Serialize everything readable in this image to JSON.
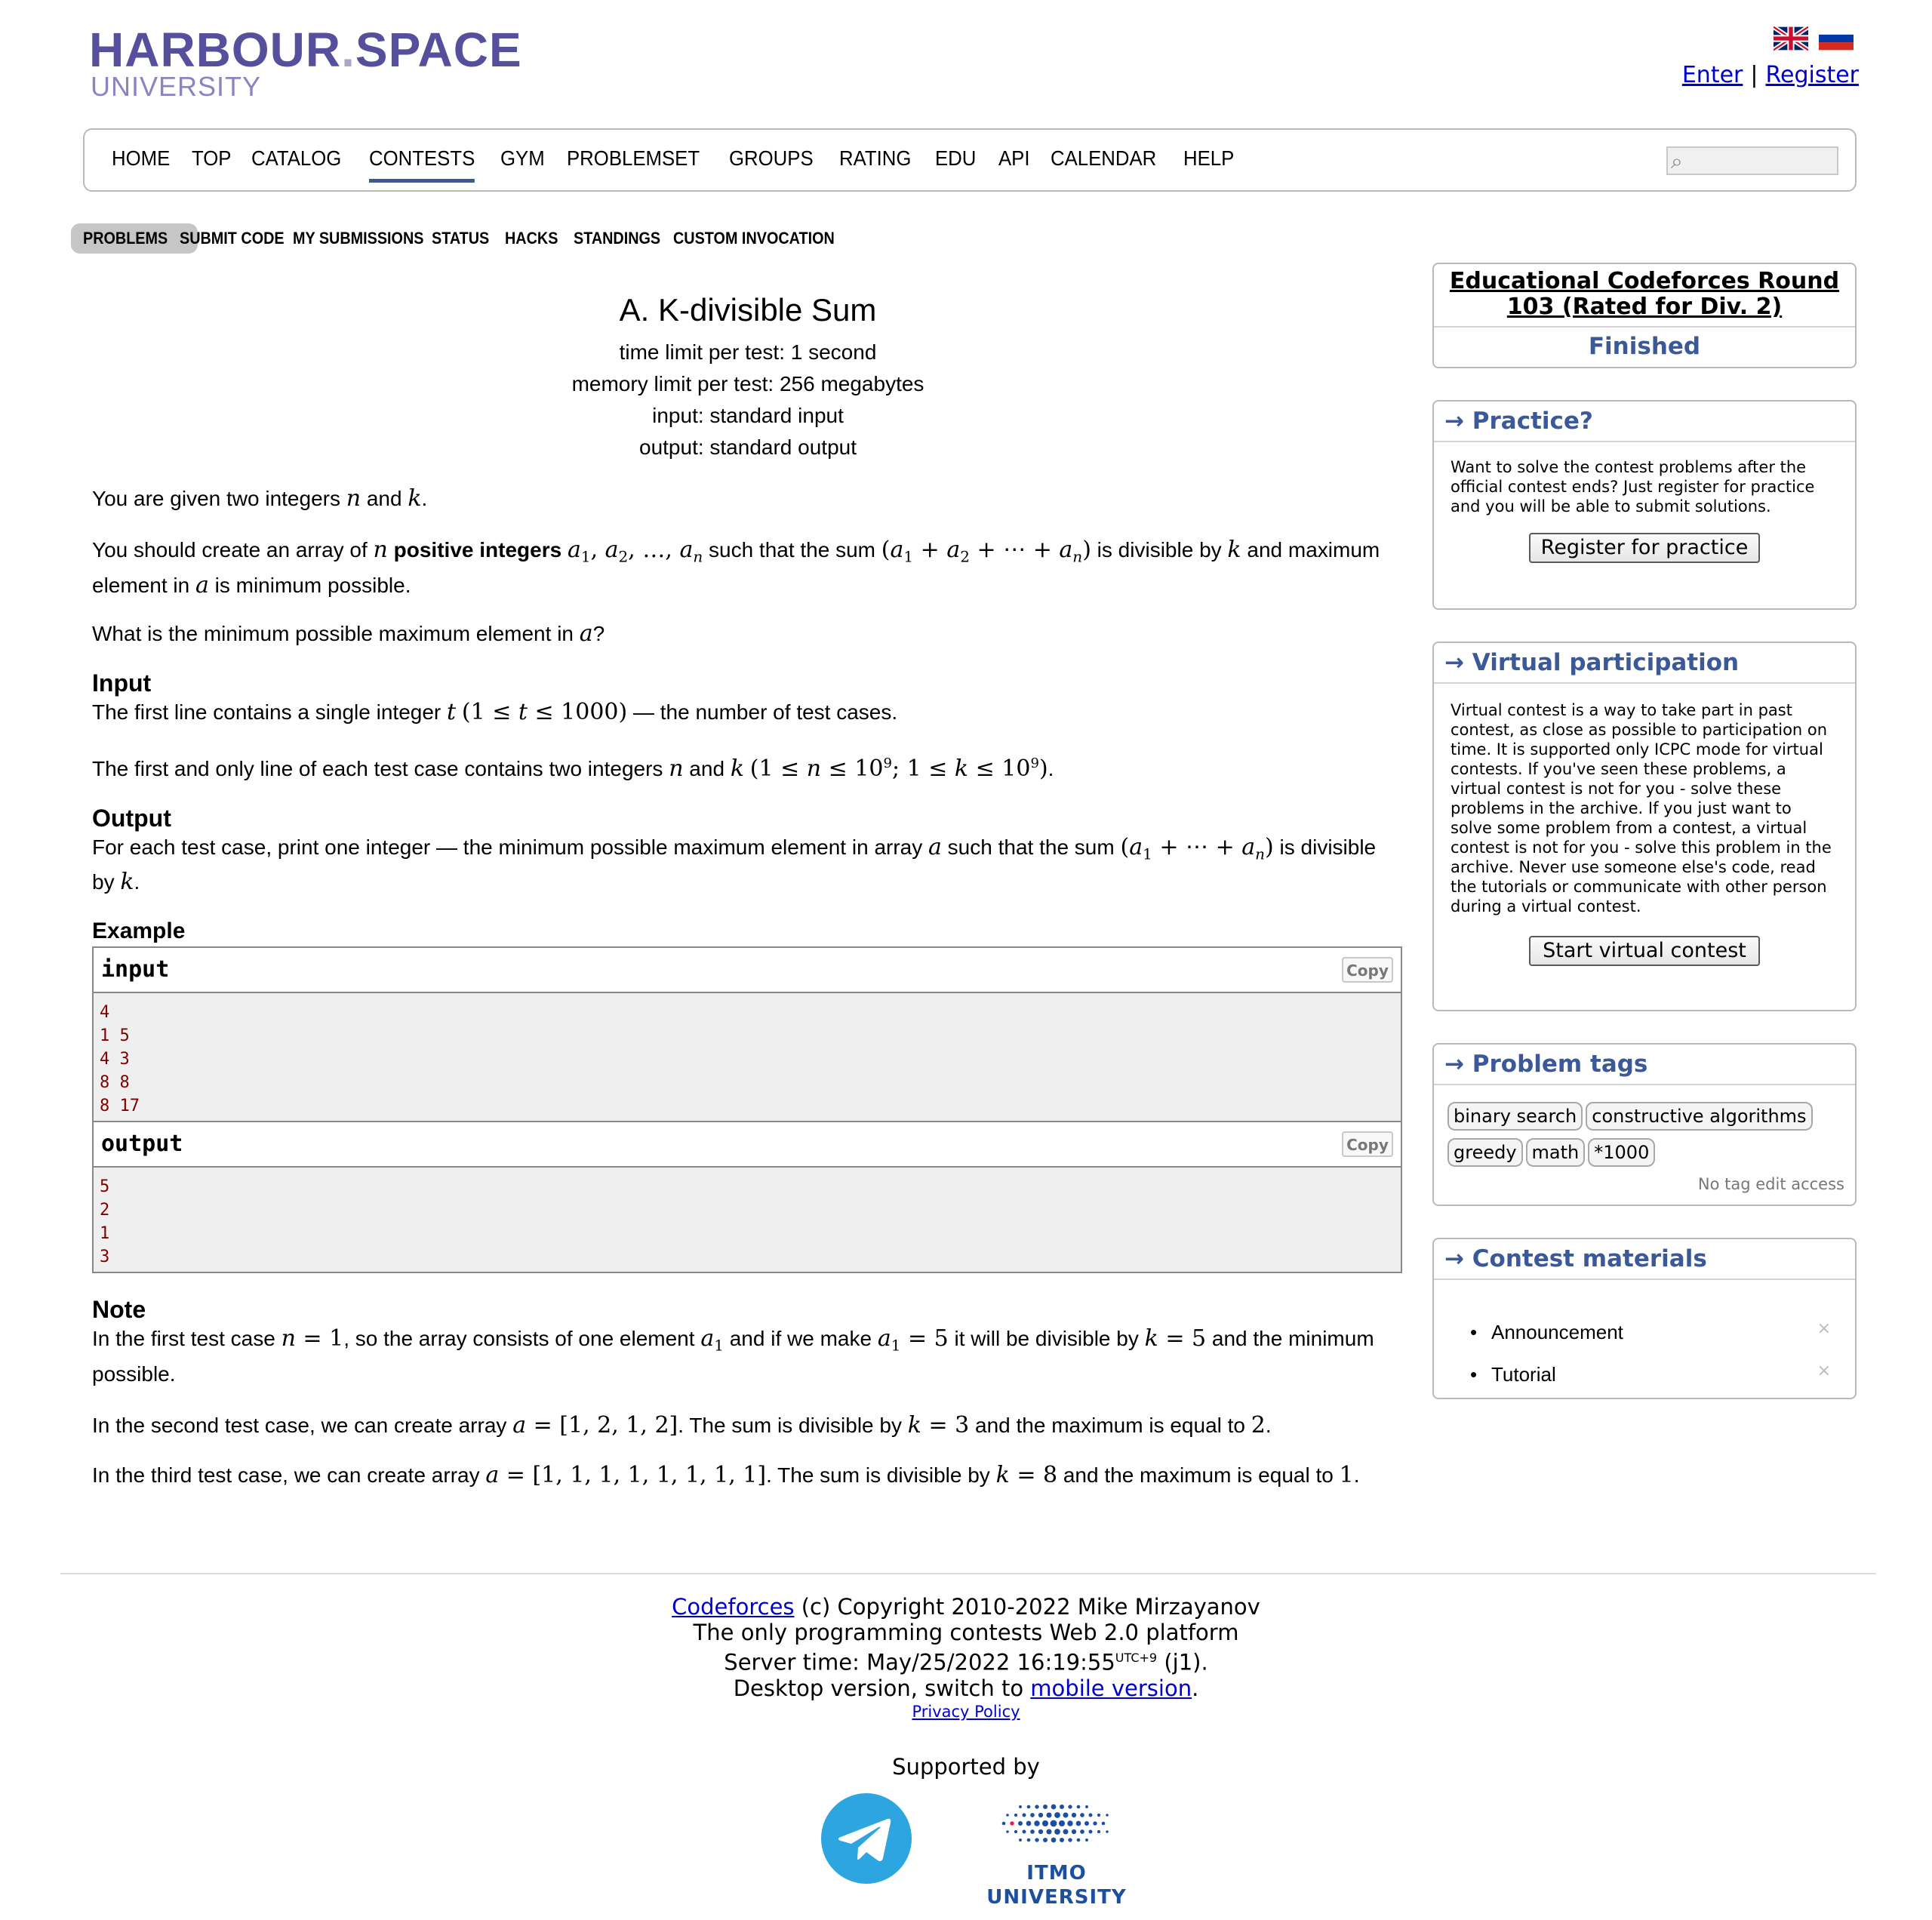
{
  "header": {
    "logo_main": "HARBOUR",
    "logo_dot": ".",
    "logo_space": "SPACE",
    "logo_sub": "UNIVERSITY",
    "enter_link": "Enter",
    "separator": "|",
    "register_link": "Register",
    "flags": [
      "english-flag",
      "russian-flag"
    ]
  },
  "main_menu": {
    "items": [
      "HOME",
      "TOP",
      "CATALOG",
      "CONTESTS",
      "GYM",
      "PROBLEMSET",
      "GROUPS",
      "RATING",
      "EDU",
      "API",
      "CALENDAR",
      "HELP"
    ],
    "current": "CONTESTS",
    "search_icon": "search-icon"
  },
  "sub_menu": {
    "items": [
      "PROBLEMS",
      "SUBMIT CODE",
      "MY SUBMISSIONS",
      "STATUS",
      "HACKS",
      "STANDINGS",
      "CUSTOM INVOCATION"
    ],
    "current": "PROBLEMS"
  },
  "problem": {
    "title": "A. K-divisible Sum",
    "time_limit": "time limit per test: 1 second",
    "memory_limit": "memory limit per test: 256 megabytes",
    "input_file": "input: standard input",
    "output_file": "output: standard output",
    "statement": {
      "p1_pre": "You are given two integers ",
      "p1_and": " and ",
      "p1_end": ".",
      "p2_pre": "You should create an array of ",
      "p2_bold": " positive integers ",
      "p2_mid": " such that the sum ",
      "p2_mid2": " is divisible by ",
      "p2_mid3": " and maximum element in ",
      "p2_end": " is minimum possible.",
      "p3_pre": "What is the minimum possible maximum element in ",
      "p3_end": "?"
    },
    "input_section": {
      "title": "Input",
      "p1_pre": "The first line contains a single integer ",
      "p1_end": " — the number of test cases.",
      "p2_pre": "The first and only line of each test case contains two integers ",
      "p2_and": " and ",
      "p2_end": "."
    },
    "output_section": {
      "title": "Output",
      "p1_pre": "For each test case, print one integer — the minimum possible maximum element in array ",
      "p1_mid": " such that the sum ",
      "p1_mid2": " is divisible by ",
      "p1_end": "."
    },
    "example_title": "Example",
    "sample_input_label": "input",
    "sample_output_label": "output",
    "copy_label": "Copy",
    "sample_input_lines": [
      "4",
      "1 5",
      "4 3",
      "8 8",
      "8 17"
    ],
    "sample_output_lines": [
      "5",
      "2",
      "1",
      "3"
    ],
    "note": {
      "title": "Note",
      "p1_pre": "In the first test case ",
      "p1_mid": ", so the array consists of one element ",
      "p1_mid2": " and if we make ",
      "p1_mid3": " it will be divisible by ",
      "p1_end": " and the minimum possible.",
      "p2_pre": "In the second test case, we can create array ",
      "p2_mid": ". The sum is divisible by ",
      "p2_mid2": " and the maximum is equal to ",
      "p2_end": ".",
      "p3_pre": "In the third test case, we can create array ",
      "p3_mid": ". The sum is divisible by ",
      "p3_mid2": " and the maximum is equal to ",
      "p3_end": "."
    }
  },
  "sidebar": {
    "contest_name": "Educational Codeforces Round 103 (Rated for Div. 2)",
    "contest_status": "Finished",
    "practice": {
      "title": "→ Practice?",
      "text": "Want to solve the contest problems after the official contest ends? Just register for practice and you will be able to submit solutions.",
      "button": "Register for practice"
    },
    "virtual": {
      "title": "→ Virtual participation",
      "text": "Virtual contest is a way to take part in past contest, as close as possible to participation on time. It is supported only ICPC mode for virtual contests. If you've seen these problems, a virtual contest is not for you - solve these problems in the archive. If you just want to solve some problem from a contest, a virtual contest is not for you - solve this problem in the archive. Never use someone else's code, read the tutorials or communicate with other person during a virtual contest.",
      "button": "Start virtual contest"
    },
    "tags": {
      "title": "→ Problem tags",
      "items": [
        "binary search",
        "constructive algorithms",
        "greedy",
        "math",
        "*1000"
      ],
      "note": "No tag edit access"
    },
    "materials": {
      "title": "→ Contest materials",
      "items": [
        "Announcement",
        "Tutorial"
      ],
      "remove_icon": "×"
    }
  },
  "footer": {
    "codeforces_link": "Codeforces",
    "copyright": " (c) Copyright 2010-2022 Mike Mirzayanov",
    "platform": "The only programming contests Web 2.0 platform",
    "server_time_pre": "Server time: May/25/2022 16:19:55",
    "server_time_tz": "UTC+9",
    "server_time_post": " (j1).",
    "desktop_pre": "Desktop version, switch to ",
    "mobile_link": "mobile version",
    "desktop_post": ".",
    "privacy": "Privacy Policy",
    "supported_by": "Supported by",
    "sponsor_itmo": "ITMO UNIVERSITY",
    "sponsor_telegram_icon": "telegram-logo-icon"
  },
  "colors": {
    "logo": "#56509c",
    "link": "#0000cc",
    "sidebar_title": "#3b5998",
    "sample_text": "#800000",
    "telegram": "#2ca5e0",
    "itmo": "#1d4fa1"
  }
}
